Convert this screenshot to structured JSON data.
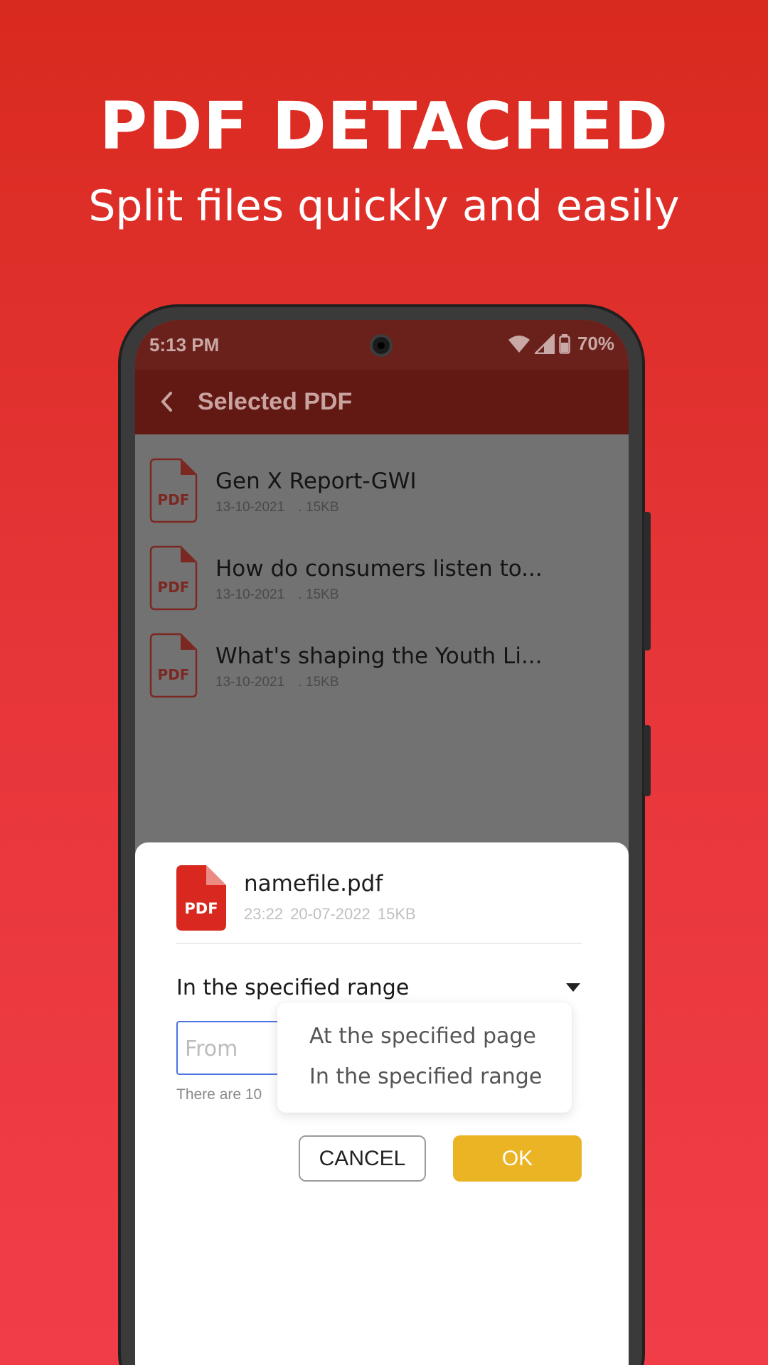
{
  "hero": {
    "title": "PDF DETACHED",
    "subtitle": "Split files quickly and easily"
  },
  "status_bar": {
    "time": "5:13 PM",
    "battery": "70%",
    "icons": [
      "wifi-icon",
      "signal-icon",
      "battery-icon"
    ]
  },
  "app_bar": {
    "back_icon": "chevron-left-icon",
    "title": "Selected PDF"
  },
  "files": [
    {
      "name": "Gen X Report-GWI",
      "date": "13-10-2021",
      "size": "15KB"
    },
    {
      "name": "How do consumers listen to...",
      "date": "13-10-2021",
      "size": "15KB"
    },
    {
      "name": "What's shaping the Youth Li...",
      "date": "13-10-2021",
      "size": "15KB"
    }
  ],
  "pdf_icon_label": "PDF",
  "sheet": {
    "file_name": "namefile.pdf",
    "file_time": "23:22",
    "file_date": "20-07-2022",
    "file_size": "15KB",
    "mode_selected": "In the specified range",
    "from_placeholder": "From",
    "hint": "There are 10",
    "dropdown_options": [
      "At the specified page",
      "In the specified range"
    ],
    "cancel_label": "CANCEL",
    "ok_label": "OK"
  },
  "colors": {
    "background_top": "#d92a1f",
    "background_bottom": "#f13d48",
    "app_bar": "#621813",
    "ok_button": "#eab424",
    "input_focus": "#4d73e3",
    "pdf_red": "#d8281f"
  }
}
